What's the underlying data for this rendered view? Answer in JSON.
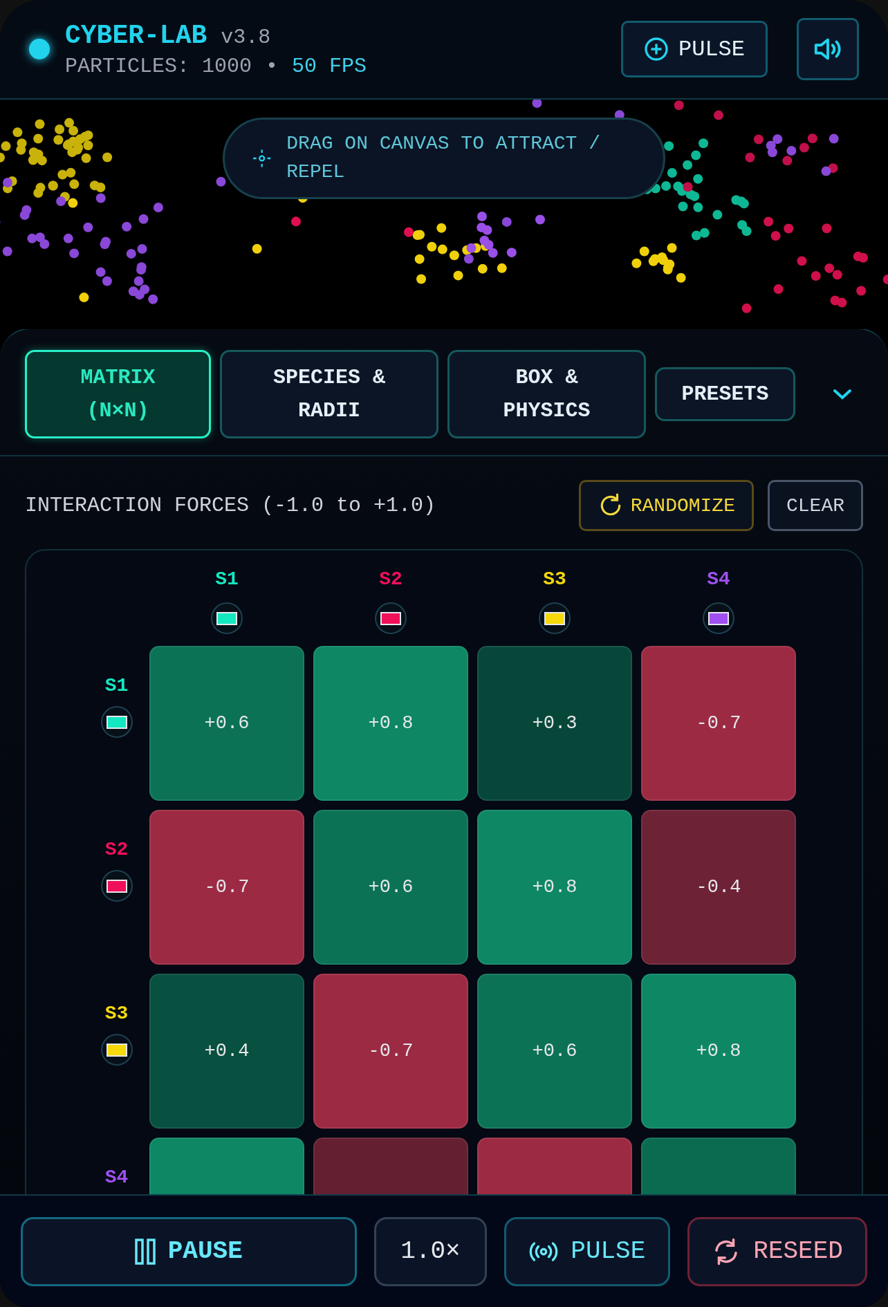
{
  "app": {
    "title": "CYBER-LAB",
    "version": "v3.8",
    "particles": "PARTICLES: 1000",
    "separator": "•",
    "fps": "50 FPS",
    "pulse": "PULSE"
  },
  "hint": "DRAG ON CANVAS TO ATTRACT / REPEL",
  "tabs": [
    {
      "label": "MATRIX (N×N)",
      "selected": true
    },
    {
      "label": "SPECIES & RADII",
      "selected": false
    },
    {
      "label": "BOX & PHYSICS",
      "selected": false
    },
    {
      "label": "PRESETS",
      "selected": false
    }
  ],
  "forces": {
    "title": "INTERACTION FORCES (-1.0 to +1.0)",
    "randomize": "RANDOMIZE",
    "clear": "CLEAR"
  },
  "columns": [
    {
      "name": "S1",
      "color": "#14e8c0"
    },
    {
      "name": "S2",
      "color": "#f0105a"
    },
    {
      "name": "S3",
      "color": "#f5d90a"
    },
    {
      "name": "S4",
      "color": "#a050f0"
    }
  ],
  "rows": [
    {
      "name": "S1",
      "color": "#14e8c0",
      "cells": [
        {
          "value": "+0.6",
          "color": "#0c7256"
        },
        {
          "value": "+0.8",
          "color": "#0d8764"
        },
        {
          "value": "+0.3",
          "color": "#07473a"
        },
        {
          "value": "-0.7",
          "color": "#9d2a43"
        }
      ]
    },
    {
      "name": "S2",
      "color": "#f0105a",
      "cells": [
        {
          "value": "-0.7",
          "color": "#9d2a43"
        },
        {
          "value": "+0.6",
          "color": "#0c7256"
        },
        {
          "value": "+0.8",
          "color": "#0d8764"
        },
        {
          "value": "-0.4",
          "color": "#6e2236"
        }
      ]
    },
    {
      "name": "S3",
      "color": "#f5d90a",
      "cells": [
        {
          "value": "+0.4",
          "color": "#085040"
        },
        {
          "value": "-0.7",
          "color": "#9d2a43"
        },
        {
          "value": "+0.6",
          "color": "#0c7256"
        },
        {
          "value": "+0.8",
          "color": "#0d8764"
        }
      ]
    },
    {
      "name": "S4",
      "color": "#a050f0",
      "cells": [
        {
          "color": "#0d8764"
        },
        {
          "color": "#641f30"
        },
        {
          "color": "#9d2a43"
        },
        {
          "color": "#0a6b50"
        }
      ]
    }
  ],
  "controls": {
    "pause": "PAUSE",
    "speed": "1.0×",
    "pulse": "PULSE",
    "reseed": "RESEED"
  }
}
